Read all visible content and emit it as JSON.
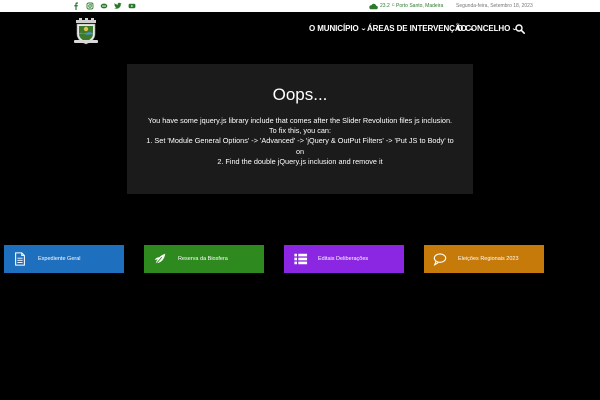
{
  "topbar": {
    "social_icons": [
      "facebook-icon",
      "instagram-icon",
      "flickr-icon",
      "twitter-icon",
      "youtube-icon"
    ],
    "weather": {
      "temperature": "23.2",
      "unit": "C",
      "location": "Porto Santo, Madeira",
      "icon": "cloud-icon"
    },
    "date": "Segunda-feira, Setembro 18, 2023"
  },
  "header": {
    "logo": "municipal-coat-of-arms",
    "nav": [
      {
        "label": "O MUNICÍPIO"
      },
      {
        "label": "ÁREAS DE INTERVENÇÃO"
      },
      {
        "label": "O CONCELHO"
      }
    ],
    "search_icon": "search-icon"
  },
  "error_box": {
    "title": "Oops...",
    "lines": [
      "You have some jquery.js library include that comes after the Slider Revolution files js inclusion.",
      "To fix this, you can:",
      "1. Set 'Module General Options' -> 'Advanced' -> 'jQuery & OutPut Filters' -> 'Put JS to Body' to",
      "on",
      "2. Find the double jQuery.js inclusion and remove it"
    ]
  },
  "tiles": [
    {
      "label": "Expediente Geral",
      "icon": "document-icon",
      "color": "#1f6fbf"
    },
    {
      "label": "Reserva da Biosfera",
      "icon": "leaf-icon",
      "color": "#2e8a1e"
    },
    {
      "label": "Editais Deliberações",
      "icon": "list-icon",
      "color": "#8b27e3"
    },
    {
      "label": "Eleições Regionais 2023",
      "icon": "speech-bubble-icon",
      "color": "#c57a0a"
    }
  ],
  "colors": {
    "accent_green": "#2b7a2b",
    "background": "#000000",
    "error_box_bg": "#1b1b1b"
  }
}
